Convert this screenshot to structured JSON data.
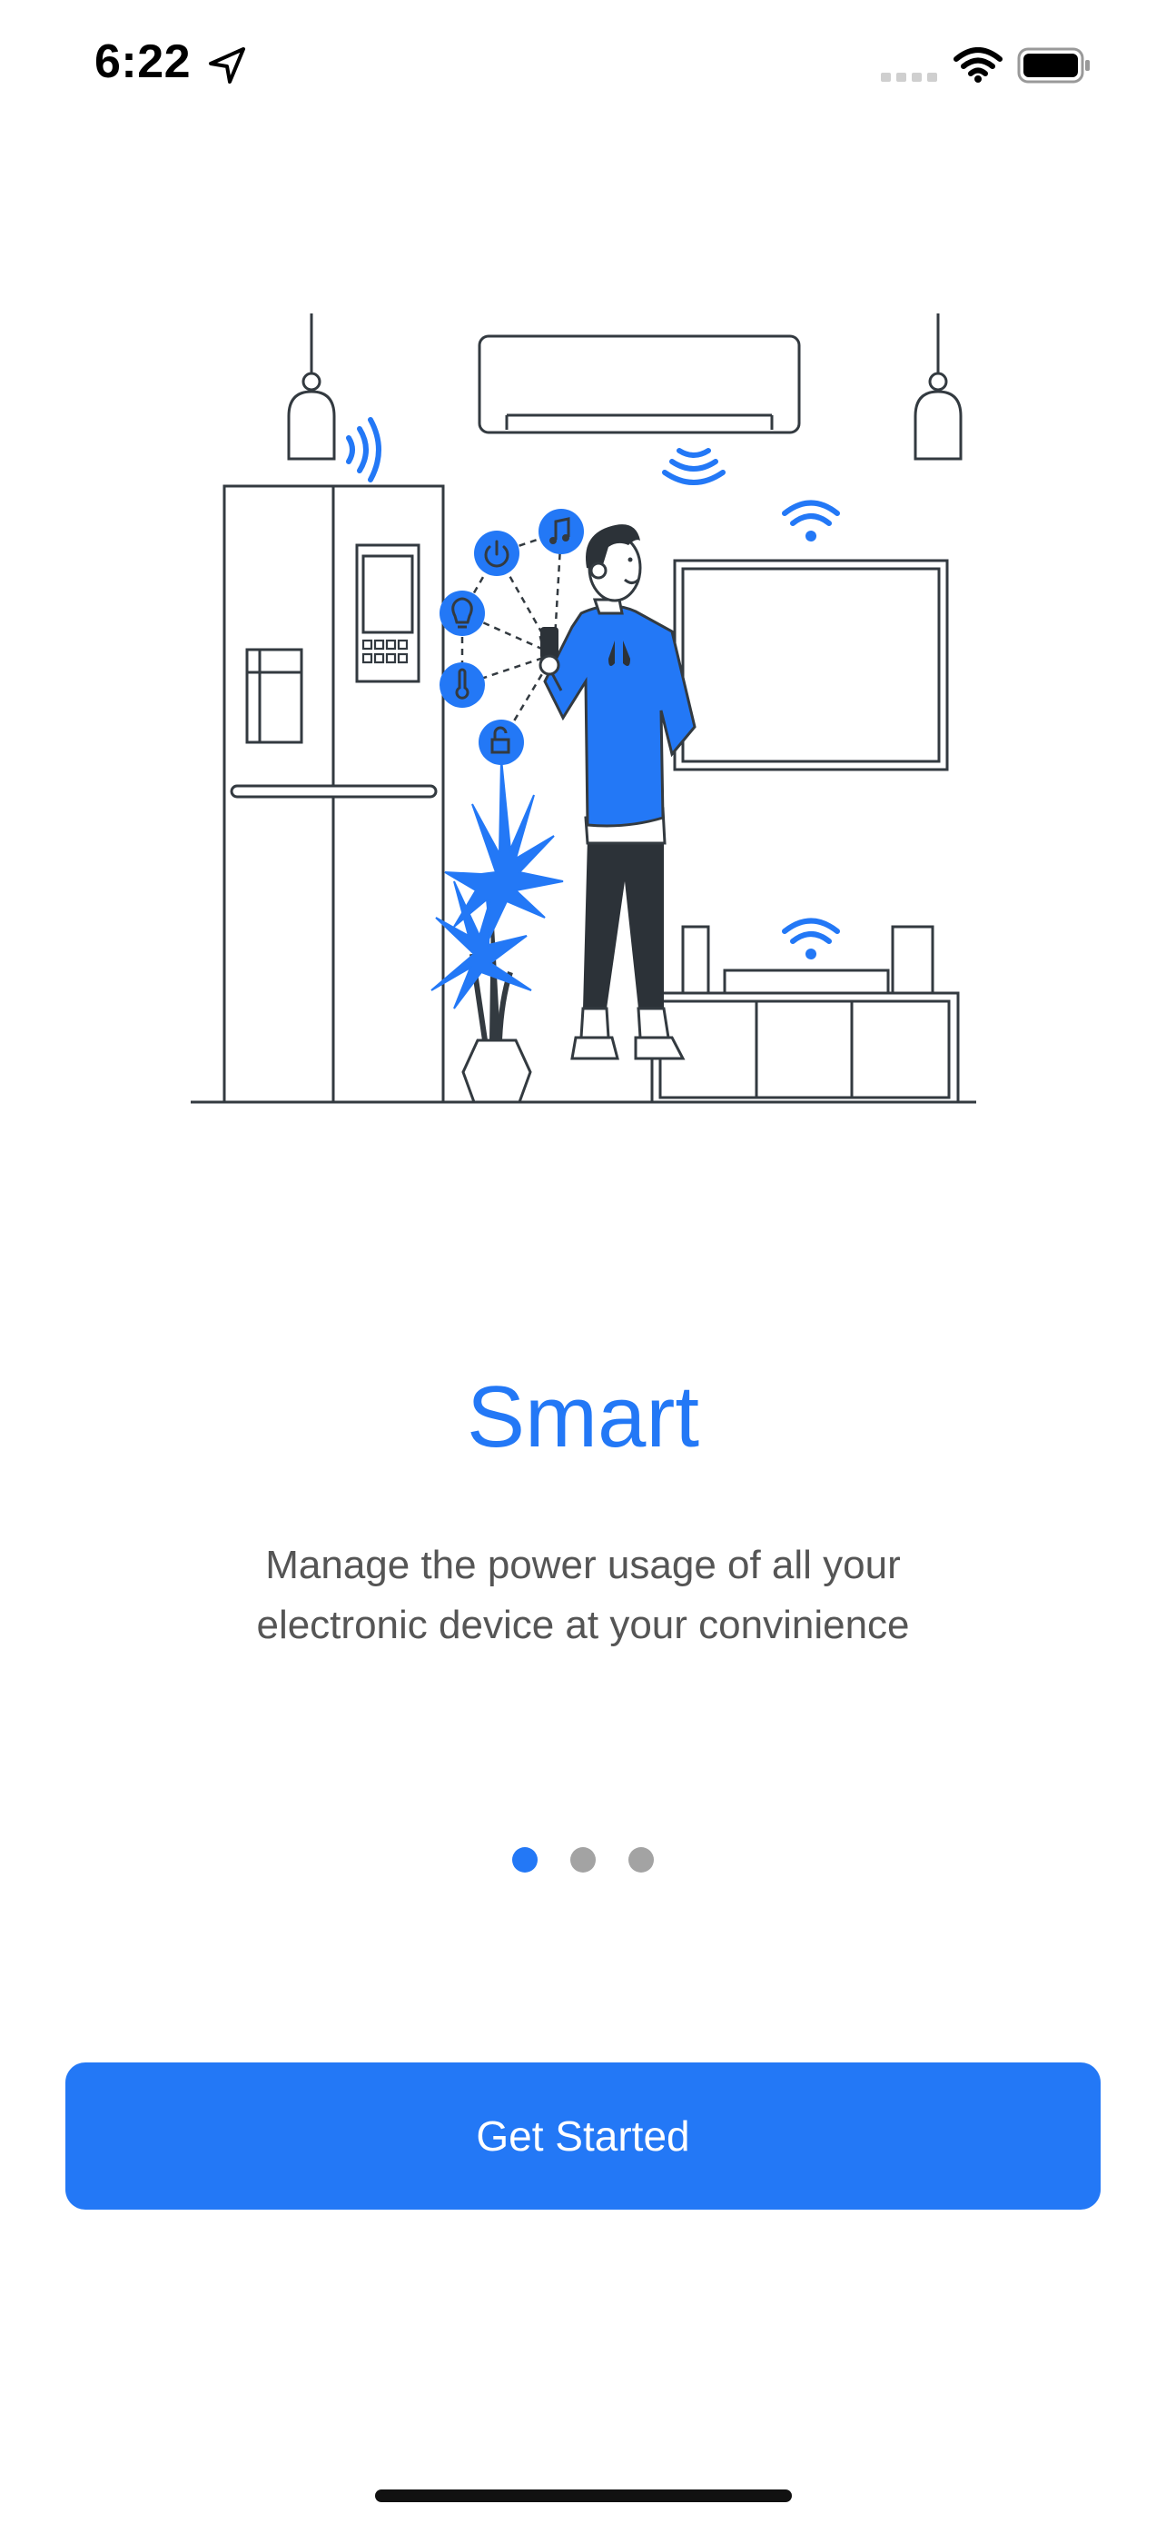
{
  "status_bar": {
    "time": "6:22",
    "icons": [
      "location-arrow-icon",
      "cellular-signal-icon",
      "wifi-icon",
      "battery-icon"
    ]
  },
  "onboarding": {
    "title": "Smart",
    "description_line1": "Manage the power usage of all your",
    "description_line2": "electronic device at your convinience",
    "page_count": 3,
    "current_page": 1
  },
  "cta": {
    "label": "Get Started"
  },
  "colors": {
    "accent": "#2378f6",
    "dot_inactive": "#a3a3a3",
    "text_secondary": "#555555",
    "outline": "#333a40"
  }
}
